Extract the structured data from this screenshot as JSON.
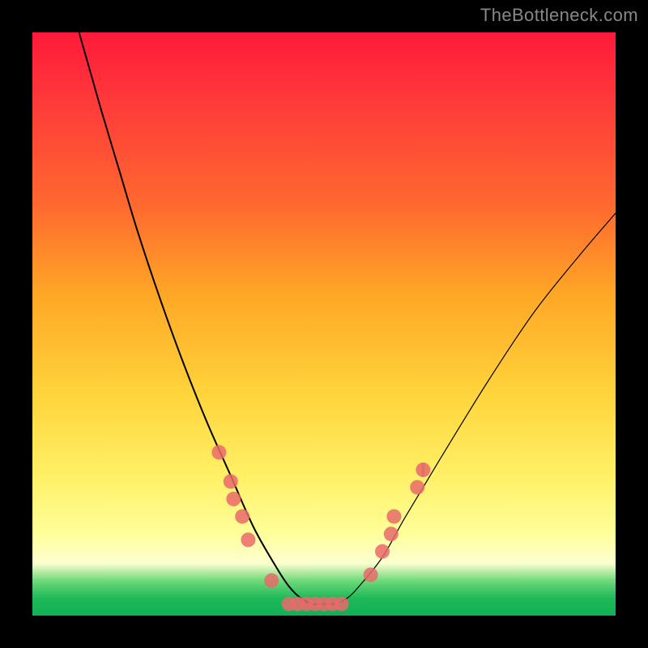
{
  "watermark": "TheBottleneck.com",
  "chart_data": {
    "type": "line",
    "title": "",
    "xlabel": "",
    "ylabel": "",
    "xlim": [
      0,
      100
    ],
    "ylim": [
      0,
      100
    ],
    "grid": false,
    "legend": false,
    "series": [
      {
        "name": "bottleneck-curve",
        "x": [
          8,
          10,
          12,
          15,
          18,
          22,
          26,
          30,
          34,
          38,
          42,
          44,
          46,
          48,
          50,
          52,
          54,
          56,
          60,
          64,
          70,
          78,
          86,
          94,
          100
        ],
        "y": [
          100,
          93,
          86,
          76,
          66,
          54,
          43,
          33,
          24,
          15,
          8,
          5,
          3,
          2,
          2,
          2,
          3,
          5,
          10,
          17,
          27,
          40,
          52,
          62,
          69
        ]
      }
    ],
    "markers": {
      "name": "highlight-beads",
      "points": [
        {
          "x": 32,
          "y": 28
        },
        {
          "x": 34,
          "y": 23
        },
        {
          "x": 34.5,
          "y": 20
        },
        {
          "x": 36,
          "y": 17
        },
        {
          "x": 37,
          "y": 13
        },
        {
          "x": 41,
          "y": 6
        },
        {
          "x": 58,
          "y": 7
        },
        {
          "x": 60,
          "y": 11
        },
        {
          "x": 61.5,
          "y": 14
        },
        {
          "x": 62,
          "y": 17
        },
        {
          "x": 66,
          "y": 22
        },
        {
          "x": 67,
          "y": 25
        }
      ],
      "bottom_cluster_x_range": [
        44,
        53
      ],
      "bottom_cluster_y": 2
    },
    "gradient_stops": [
      {
        "pos": 0,
        "color": "#ff1a3a"
      },
      {
        "pos": 30,
        "color": "#ff6a2f"
      },
      {
        "pos": 62,
        "color": "#ffd43b"
      },
      {
        "pos": 86,
        "color": "#ffff99"
      },
      {
        "pos": 94,
        "color": "#6fd97a"
      },
      {
        "pos": 100,
        "color": "#12af55"
      }
    ]
  }
}
